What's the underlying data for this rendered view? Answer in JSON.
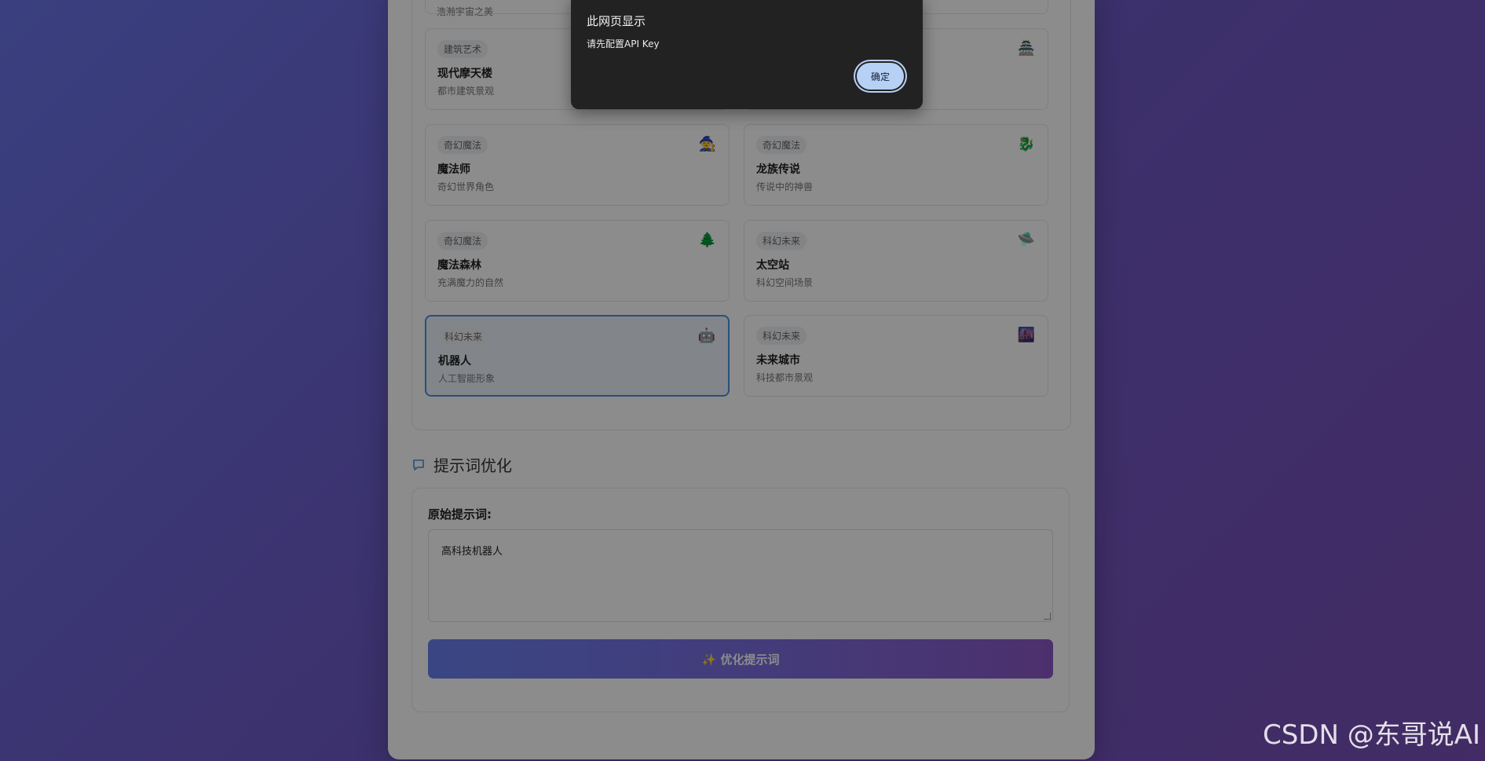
{
  "gallery": {
    "partial_top_desc": "浩瀚宇宙之美",
    "templates": [
      {
        "category": "建筑艺术",
        "name": "现代摩天楼",
        "desc": "都市建筑景观",
        "emoji": ""
      },
      {
        "category": "",
        "name": "",
        "desc": "",
        "emoji": "🏯"
      },
      {
        "category": "奇幻魔法",
        "name": "魔法师",
        "desc": "奇幻世界角色",
        "emoji": "🧙"
      },
      {
        "category": "奇幻魔法",
        "name": "龙族传说",
        "desc": "传说中的神兽",
        "emoji": "🐉"
      },
      {
        "category": "奇幻魔法",
        "name": "魔法森林",
        "desc": "充满魔力的自然",
        "emoji": "🌲"
      },
      {
        "category": "科幻未来",
        "name": "太空站",
        "desc": "科幻空间场景",
        "emoji": "🛸"
      },
      {
        "category": "科幻未来",
        "name": "机器人",
        "desc": "人工智能形象",
        "emoji": "🤖"
      },
      {
        "category": "科幻未来",
        "name": "未来城市",
        "desc": "科技都市景观",
        "emoji": "🌆"
      }
    ]
  },
  "prompt_section": {
    "title": "提示词优化",
    "label": "原始提示词:",
    "value": "高科技机器人",
    "button": "✨ 优化提示词"
  },
  "dialog": {
    "title": "此网页显示",
    "message": "请先配置API Key",
    "ok": "确定"
  },
  "watermark": "CSDN @东哥说AI"
}
